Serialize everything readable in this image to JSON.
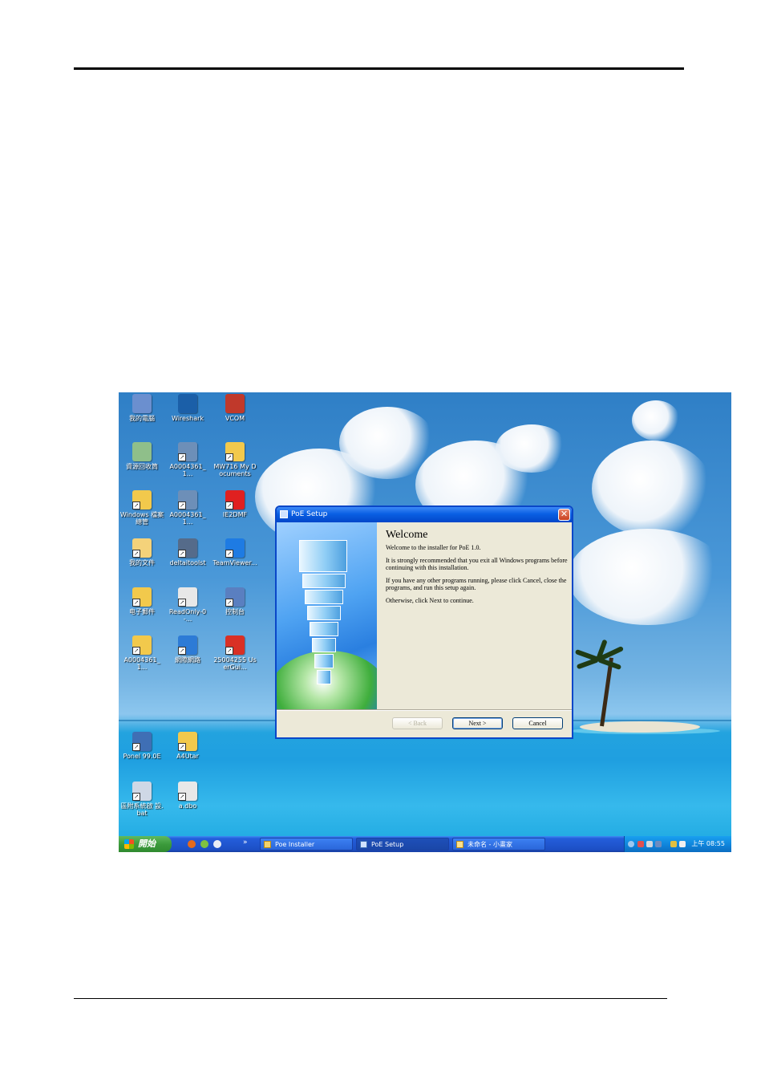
{
  "desktop_icons": [
    {
      "label": "我的電腦",
      "icon": "computer-icon",
      "color": "#6b8fcf"
    },
    {
      "label": "Wireshark",
      "icon": "wireshark-icon",
      "color": "#1b5fa8"
    },
    {
      "label": "VCOM",
      "icon": "vcom-icon",
      "color": "#c0392b"
    },
    {
      "label": "資源回收筒",
      "icon": "recycle-bin-icon",
      "color": "#8fbf8a"
    },
    {
      "label": "A0004361_1...",
      "icon": "zip-file-icon",
      "color": "#6d8fb8"
    },
    {
      "label": "MW716 My Documents",
      "icon": "folder-shortcut-icon",
      "color": "#f2c94c"
    },
    {
      "label": "Windows 檔案總管",
      "icon": "explorer-icon",
      "color": "#f2c94c"
    },
    {
      "label": "A0004361_1...",
      "icon": "zip-file-icon",
      "color": "#6d8fb8"
    },
    {
      "label": "IE2DMF",
      "icon": "mp-icon",
      "color": "#e02020"
    },
    {
      "label": "我的文件",
      "icon": "documents-icon",
      "color": "#f4d27a"
    },
    {
      "label": "deltaitoolst",
      "icon": "program-icon",
      "color": "#556b8a"
    },
    {
      "label": "TeamViewer...",
      "icon": "teamviewer-icon",
      "color": "#1e7be3"
    },
    {
      "label": "电子郵件",
      "icon": "email-icon",
      "color": "#f2c94c"
    },
    {
      "label": "ReadOnly-0-...",
      "icon": "text-file-icon",
      "color": "#e8e8e8"
    },
    {
      "label": "控制台",
      "icon": "control-panel-icon",
      "color": "#5a7fc0"
    },
    {
      "label": "A0004361_1...",
      "icon": "folder-icon",
      "color": "#f2c94c"
    },
    {
      "label": "網際網路",
      "icon": "internet-icon",
      "color": "#2d7bd6"
    },
    {
      "label": "25004255 UserGui...",
      "icon": "pdf-icon",
      "color": "#d93025"
    },
    {
      "label": "Ponel 99.0E",
      "icon": "program-icon",
      "color": "#3f6fb5"
    },
    {
      "label": "A4Utar",
      "icon": "folder-icon",
      "color": "#f2c94c"
    },
    {
      "label": "區附系統啟 設.bat",
      "icon": "batch-file-icon",
      "color": "#cfd8e6"
    },
    {
      "label": "a.dbo",
      "icon": "file-icon",
      "color": "#e8e8e8"
    }
  ],
  "dialog": {
    "title": "PoE Setup",
    "heading": "Welcome",
    "paragraphs": [
      "Welcome to the installer for PoE 1.0.",
      "It is strongly recommended that you exit all Windows programs before continuing with this installation.",
      "If you have any other programs running, please click Cancel, close the programs, and run this setup again.",
      "Otherwise, click Next to continue."
    ],
    "buttons": {
      "back": "< Back",
      "next": "Next >",
      "cancel": "Cancel"
    }
  },
  "taskbar": {
    "start_label": "開始",
    "tasks": [
      {
        "label": "Poe Installer",
        "active": false
      },
      {
        "label": "PoE Setup",
        "active": true
      },
      {
        "label": "未命名 - 小畫家",
        "active": false
      }
    ],
    "clock": "上午 08:55"
  }
}
